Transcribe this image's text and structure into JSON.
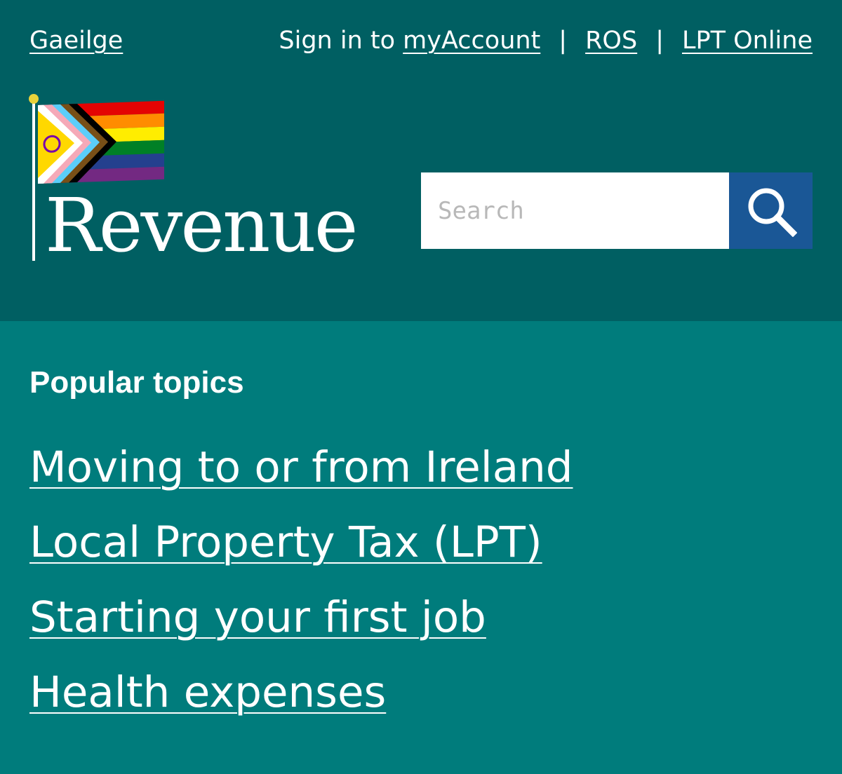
{
  "top_nav": {
    "language_link": "Gaeilge",
    "sign_in_prefix": "Sign in to",
    "my_account_link": "myAccount",
    "separator": "|",
    "ros_link": "ROS",
    "lpt_online_link": "LPT Online"
  },
  "logo": {
    "wordmark": "Revenue",
    "flag_icon": "progress-pride-flag-icon"
  },
  "search": {
    "placeholder": "Search",
    "value": "",
    "button_icon": "search-icon"
  },
  "popular_topics": {
    "heading": "Popular topics",
    "items": [
      {
        "label": "Moving to or from Ireland"
      },
      {
        "label": "Local Property Tax (LPT)"
      },
      {
        "label": "Starting your first job"
      },
      {
        "label": "Health expenses"
      }
    ]
  },
  "colors": {
    "header_background": "#005f62",
    "page_background": "#007c7c",
    "search_button": "#1a5796",
    "text": "#ffffff"
  }
}
